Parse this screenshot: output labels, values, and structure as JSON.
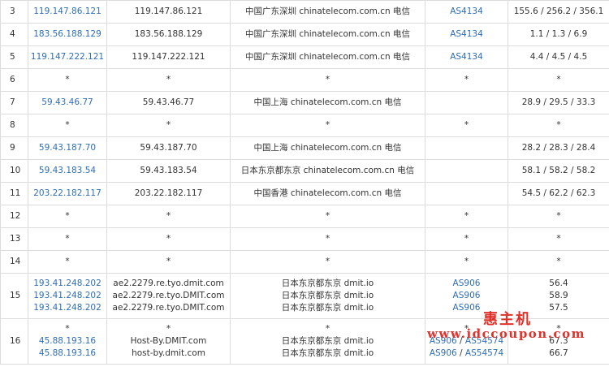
{
  "rows": [
    {
      "hop": "3",
      "ips": [
        "119.147.86.121"
      ],
      "hosts": [
        "119.147.86.121"
      ],
      "locs": [
        "中国广东深圳 chinatelecom.com.cn 电信"
      ],
      "asns": [
        "AS4134"
      ],
      "times": [
        "155.6 / 256.2 / 356.1"
      ]
    },
    {
      "hop": "4",
      "ips": [
        "183.56.188.129"
      ],
      "hosts": [
        "183.56.188.129"
      ],
      "locs": [
        "中国广东深圳 chinatelecom.com.cn 电信"
      ],
      "asns": [
        "AS4134"
      ],
      "times": [
        "1.1 / 1.3 / 6.9"
      ]
    },
    {
      "hop": "5",
      "ips": [
        "119.147.222.121"
      ],
      "hosts": [
        "119.147.222.121"
      ],
      "locs": [
        "中国广东深圳 chinatelecom.com.cn 电信"
      ],
      "asns": [
        "AS4134"
      ],
      "times": [
        "4.4 / 4.5 / 4.5"
      ]
    },
    {
      "hop": "6",
      "ips": [
        "*"
      ],
      "hosts": [
        "*"
      ],
      "locs": [
        "*"
      ],
      "asns": [
        "*"
      ],
      "times": [
        "*"
      ]
    },
    {
      "hop": "7",
      "ips": [
        "59.43.46.77"
      ],
      "hosts": [
        "59.43.46.77"
      ],
      "locs": [
        "中国上海 chinatelecom.com.cn 电信"
      ],
      "asns": [
        ""
      ],
      "times": [
        "28.9 / 29.5 / 33.3"
      ]
    },
    {
      "hop": "8",
      "ips": [
        "*"
      ],
      "hosts": [
        "*"
      ],
      "locs": [
        "*"
      ],
      "asns": [
        "*"
      ],
      "times": [
        "*"
      ]
    },
    {
      "hop": "9",
      "ips": [
        "59.43.187.70"
      ],
      "hosts": [
        "59.43.187.70"
      ],
      "locs": [
        "中国上海 chinatelecom.com.cn 电信"
      ],
      "asns": [
        ""
      ],
      "times": [
        "28.2 / 28.3 / 28.4"
      ]
    },
    {
      "hop": "10",
      "ips": [
        "59.43.183.54"
      ],
      "hosts": [
        "59.43.183.54"
      ],
      "locs": [
        "日本东京都东京 chinatelecom.com.cn 电信"
      ],
      "asns": [
        ""
      ],
      "times": [
        "58.1 / 58.2 / 58.2"
      ]
    },
    {
      "hop": "11",
      "ips": [
        "203.22.182.117"
      ],
      "hosts": [
        "203.22.182.117"
      ],
      "locs": [
        "中国香港 chinatelecom.com.cn 电信"
      ],
      "asns": [
        ""
      ],
      "times": [
        "54.5 / 62.2 / 62.3"
      ]
    },
    {
      "hop": "12",
      "ips": [
        "*"
      ],
      "hosts": [
        "*"
      ],
      "locs": [
        "*"
      ],
      "asns": [
        "*"
      ],
      "times": [
        "*"
      ]
    },
    {
      "hop": "13",
      "ips": [
        "*"
      ],
      "hosts": [
        "*"
      ],
      "locs": [
        "*"
      ],
      "asns": [
        "*"
      ],
      "times": [
        "*"
      ]
    },
    {
      "hop": "14",
      "ips": [
        "*"
      ],
      "hosts": [
        "*"
      ],
      "locs": [
        "*"
      ],
      "asns": [
        "*"
      ],
      "times": [
        "*"
      ]
    },
    {
      "hop": "15",
      "ips": [
        "193.41.248.202",
        "193.41.248.202",
        "193.41.248.202"
      ],
      "hosts": [
        "ae2.2279.re.tyo.dmit.com",
        "ae2.2279.re.tyo.DMIT.com",
        "ae2.2279.re.tyo.DMIT.com"
      ],
      "locs": [
        "日本东京都东京 dmit.io",
        "日本东京都东京 dmit.io",
        "日本东京都东京 dmit.io"
      ],
      "asns": [
        "AS906",
        "AS906",
        "AS906"
      ],
      "times": [
        "56.4",
        "58.9",
        "57.5"
      ]
    },
    {
      "hop": "16",
      "ips": [
        "*",
        "45.88.193.16",
        "45.88.193.16"
      ],
      "hosts": [
        "*",
        "Host-By.DMIT.com",
        "host-by.dmit.com"
      ],
      "locs": [
        "*",
        "日本东京都东京 dmit.io",
        "日本东京都东京 dmit.io"
      ],
      "asns": [
        "*",
        "AS906 / AS54574",
        "AS906 / AS54574"
      ],
      "times": [
        "*",
        "67.3",
        "66.7"
      ]
    }
  ],
  "watermark": {
    "title": "惠主机",
    "url": "www.idccoupon.com"
  }
}
